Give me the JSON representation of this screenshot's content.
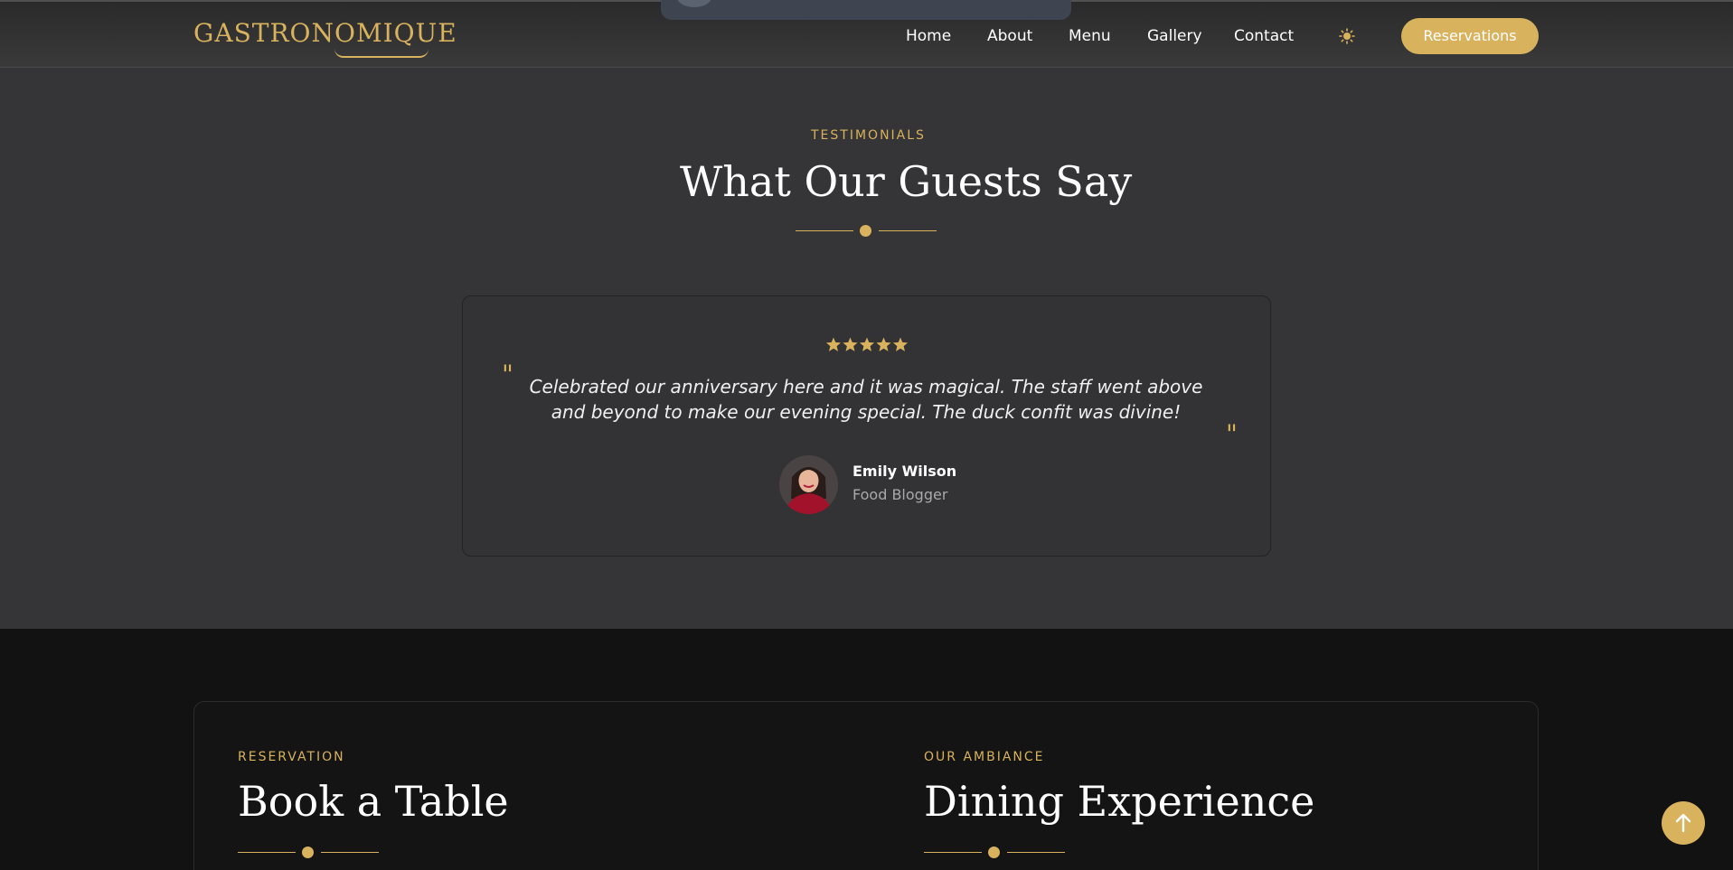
{
  "brand": {
    "logo": "GASTRONOMIQUE",
    "accent_color": "#d8b25c"
  },
  "nav": {
    "items": [
      "Home",
      "About",
      "Menu",
      "Gallery",
      "Contact"
    ],
    "theme_icon": "sun-icon",
    "cta": "Reservations"
  },
  "testimonials": {
    "eyebrow": "TESTIMONIALS",
    "title": "What Our Guests Say",
    "rating": 5,
    "quote": "Celebrated our anniversary here and it was magical. The staff went above and beyond to make our evening special. The duck confit was divine!",
    "author": {
      "name": "Emily Wilson",
      "role": "Food Blogger"
    }
  },
  "reservation": {
    "eyebrow": "RESERVATION",
    "title": "Book a Table"
  },
  "ambiance": {
    "eyebrow": "OUR AMBIANCE",
    "title": "Dining Experience"
  },
  "scroll_top_icon": "arrow-up-icon"
}
